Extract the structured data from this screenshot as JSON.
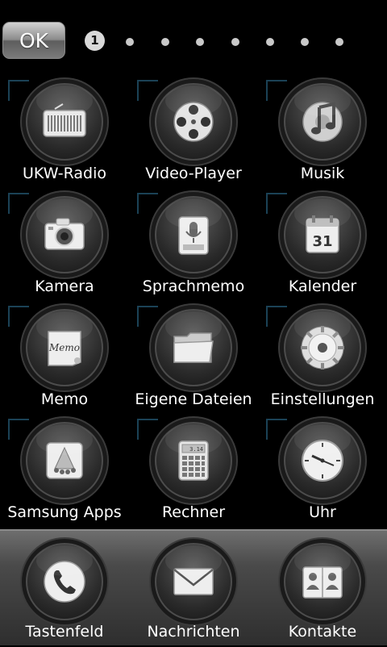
{
  "topbar": {
    "ok_label": "OK",
    "current_page": "1",
    "page_count": 8
  },
  "grid": {
    "apps": [
      {
        "label": "UKW-Radio",
        "icon": "radio-icon"
      },
      {
        "label": "Video-Player",
        "icon": "film-reel-icon"
      },
      {
        "label": "Musik",
        "icon": "music-note-icon"
      },
      {
        "label": "Kamera",
        "icon": "camera-icon"
      },
      {
        "label": "Sprachmemo",
        "icon": "microphone-icon"
      },
      {
        "label": "Kalender",
        "icon": "calendar-icon"
      },
      {
        "label": "Memo",
        "icon": "memo-note-icon"
      },
      {
        "label": "Eigene Dateien",
        "icon": "folder-icon"
      },
      {
        "label": "Einstellungen",
        "icon": "gear-icon"
      },
      {
        "label": "Samsung Apps",
        "icon": "apps-store-icon"
      },
      {
        "label": "Rechner",
        "icon": "calculator-icon"
      },
      {
        "label": "Uhr",
        "icon": "clock-icon"
      }
    ]
  },
  "calendar_icon_day": "31",
  "calculator_display": "3.14",
  "memo_icon_text": "Memo",
  "dock": {
    "items": [
      {
        "label": "Tastenfeld",
        "icon": "phone-icon"
      },
      {
        "label": "Nachrichten",
        "icon": "envelope-icon"
      },
      {
        "label": "Kontakte",
        "icon": "contacts-book-icon"
      }
    ]
  }
}
